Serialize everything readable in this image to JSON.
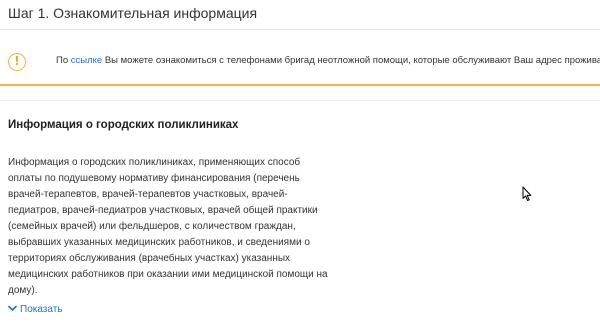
{
  "step": {
    "title": "Шаг 1. Ознакомительная информация"
  },
  "notice": {
    "icon": "exclamation-icon",
    "accent_color": "#e8b84a",
    "prefix": "По ",
    "link_label": "ссылке",
    "suffix": " Вы можете ознакомиться с телефонами бригад неотложной помощи, которые обслуживают Ваш адрес проживания."
  },
  "section": {
    "title": "Информация о городских поликлиниках",
    "body": "Информация о городских поликлиниках, применяющих способ оплаты по подушевому нормативу финансирования (перечень врачей-терапевтов, врачей-терапевтов участковых, врачей-педиатров, врачей-педиатров участковых, врачей общей практики (семейных врачей) или фельдшеров, с количеством граждан, выбравших указанных медицинских работников, и сведениями о территориях обслуживания (врачебных участках) указанных медицинских работников при оказании ими медицинской помощи на дому).",
    "show_more_label": "Показать",
    "link_color": "#2a6fc0"
  }
}
